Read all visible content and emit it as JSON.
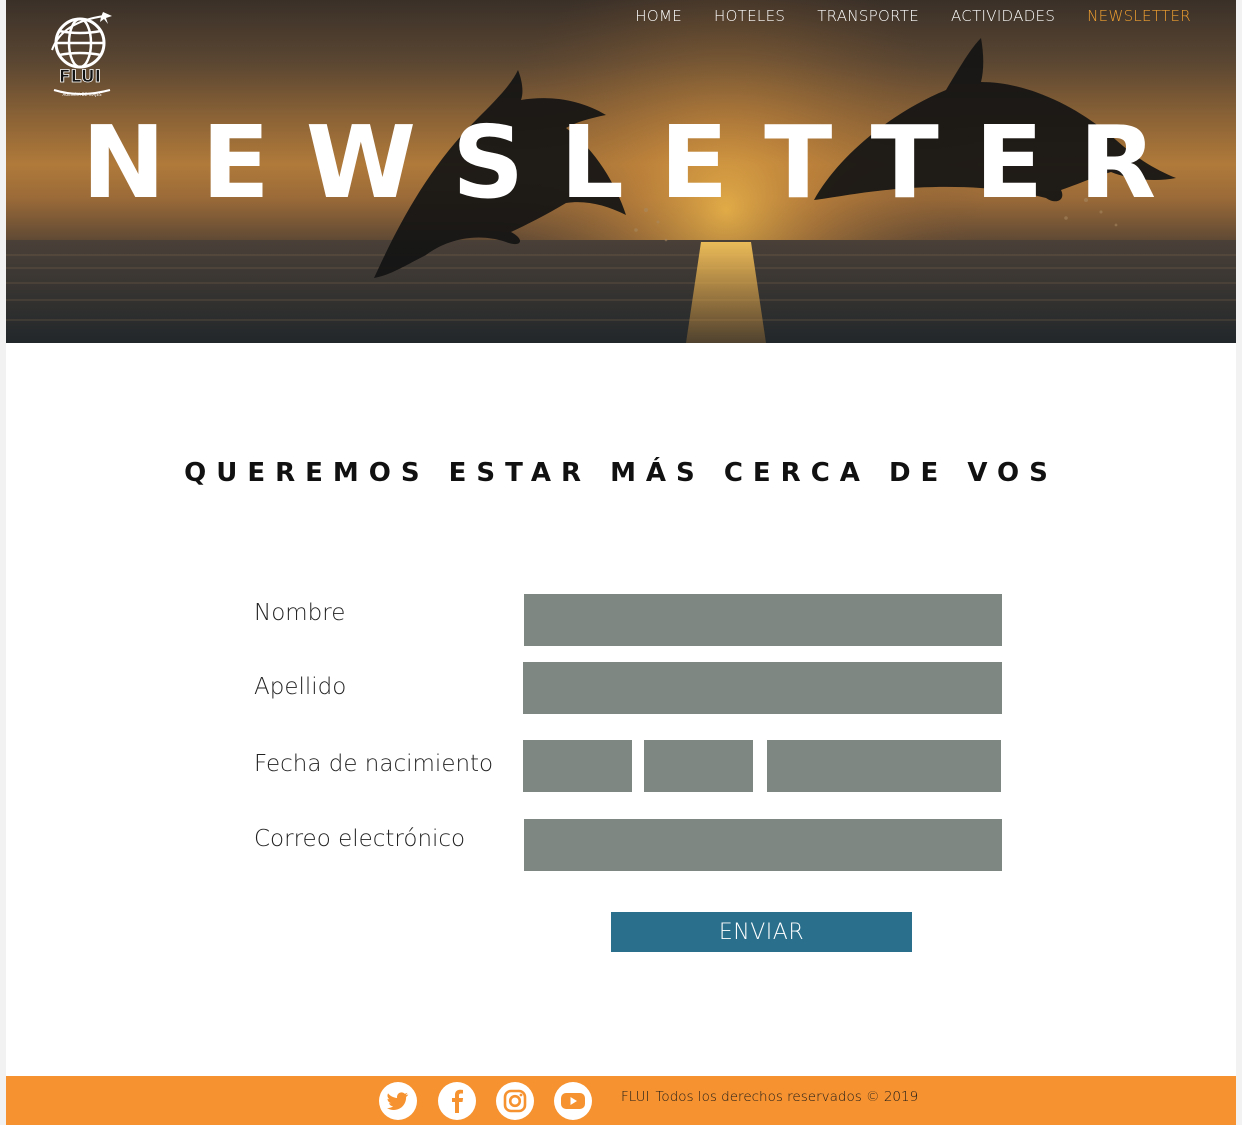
{
  "brand": {
    "logo_text": "FLUI",
    "logo_tagline": "AGENCIA DE VIAJES"
  },
  "nav": {
    "items": [
      {
        "label": "HOME"
      },
      {
        "label": "HOTELES"
      },
      {
        "label": "TRANSPORTE"
      },
      {
        "label": "ACTIVIDADES"
      },
      {
        "label": "NEWSLETTER",
        "active": true
      }
    ],
    "active_color": "#f0a030"
  },
  "hero": {
    "title": "NEWSLETTER"
  },
  "main": {
    "heading": "QUEREMOS ESTAR MÁS CERCA DE VOS"
  },
  "form": {
    "nombre_label": "Nombre",
    "nombre_value": "",
    "apellido_label": "Apellido",
    "apellido_value": "",
    "fecha_label": "Fecha de nacimiento",
    "fecha_day": "",
    "fecha_month": "",
    "fecha_year": "",
    "correo_label": "Correo electrónico",
    "correo_value": "",
    "submit_label": "ENVIAR",
    "field_color": "#7f8783",
    "button_color": "#2a6f8c"
  },
  "footer": {
    "social": [
      "twitter-icon",
      "facebook-icon",
      "instagram-icon",
      "youtube-icon"
    ],
    "brand": "FLUI",
    "copyright": "Todos los derechos reservados © 2019",
    "background": "#f6922f"
  }
}
